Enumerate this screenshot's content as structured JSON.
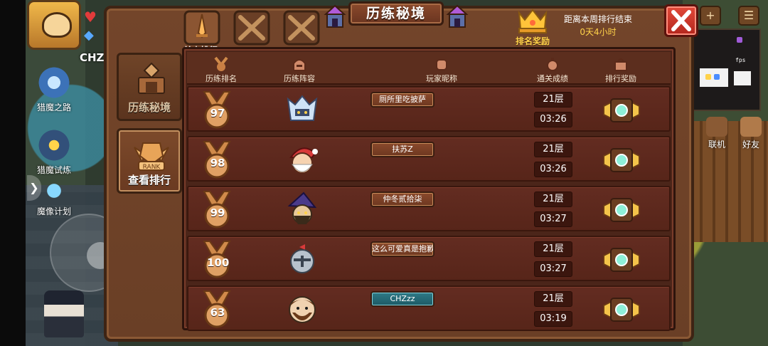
{
  "hud": {
    "player_name": "CHZ",
    "left_items": [
      "猎魔之路",
      "猎魔试炼",
      "魔像计划"
    ],
    "right_items": [
      "联机",
      "好友"
    ],
    "fps_label": "fps"
  },
  "panel": {
    "title": "历练秘境",
    "tab_label": "单人排行",
    "reward_label": "排名奖励",
    "countdown_label": "距离本周排行结束",
    "countdown_time": "0天4小时",
    "side_tabs": [
      "历练秘境",
      "查看排行"
    ]
  },
  "table": {
    "headers": [
      "历练排名",
      "历练阵容",
      "玩家昵称",
      "通关成绩",
      "排行奖励"
    ],
    "rows": [
      {
        "rank": "97",
        "name": "厕所里吃披萨",
        "floor": "21层",
        "time": "03:26",
        "avatar": "armored-knight-avatar"
      },
      {
        "rank": "98",
        "name": "扶苏Z",
        "floor": "21层",
        "time": "03:26",
        "avatar": "santa-avatar"
      },
      {
        "rank": "99",
        "name": "仲冬贰拾柒",
        "floor": "21层",
        "time": "03:27",
        "avatar": "wizard-avatar"
      },
      {
        "rank": "100",
        "name": "这么可爱真是抱歉",
        "floor": "21层",
        "time": "03:27",
        "avatar": "knight-helmet-avatar"
      },
      {
        "rank": "63",
        "name": "CHZzz",
        "floor": "21层",
        "time": "03:19",
        "avatar": "bearded-hero-avatar",
        "self": true
      }
    ]
  },
  "colors": {
    "panel_wood": "#6a3f26",
    "row_bg": "#572519",
    "medal_bronze": "#d08a4a",
    "accent_gold": "#ffd24a",
    "close_red": "#c8332a",
    "self_name_teal": "#2f7a86"
  }
}
